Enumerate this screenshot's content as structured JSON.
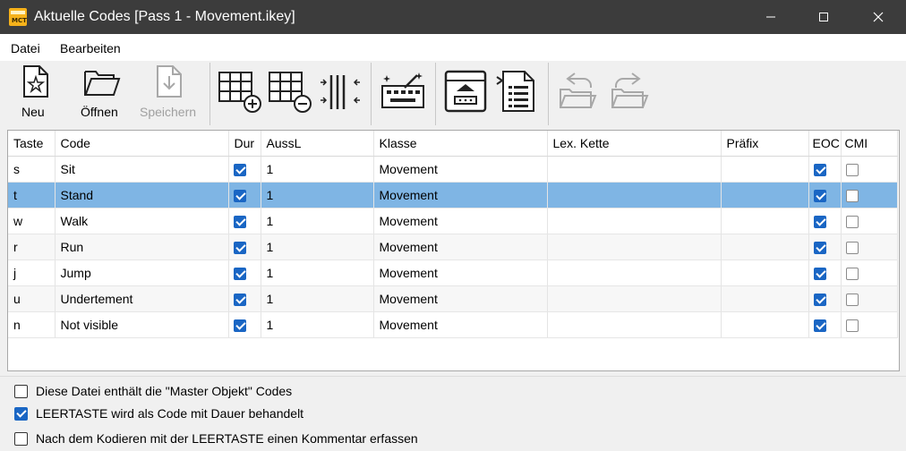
{
  "window": {
    "title": "Aktuelle Codes [Pass 1 - Movement.ikey]",
    "logo_text": "MCT",
    "controls": {
      "minimize": "minimize-icon",
      "maximize": "maximize-icon",
      "close": "close-icon"
    }
  },
  "menu": {
    "items": [
      "Datei",
      "Bearbeiten"
    ]
  },
  "toolbar": {
    "new_label": "Neu",
    "open_label": "Öffnen",
    "save_label": "Speichern",
    "icons": [
      "new-file-icon",
      "open-folder-icon",
      "save-icon",
      "add-row-icon",
      "remove-row-icon",
      "columns-icon",
      "wizard-icon",
      "export-icon",
      "document-list-icon",
      "undo-folder-icon",
      "redo-folder-icon"
    ]
  },
  "table": {
    "columns": [
      "Taste",
      "Code",
      "Dur",
      "AussL",
      "Klasse",
      "Lex. Kette",
      "Präfix",
      "EOC",
      "CMI"
    ],
    "rows": [
      {
        "key": "s",
        "code": "Sit",
        "dur": true,
        "aussl": "1",
        "klasse": "Movement",
        "lex": "",
        "prefix": "",
        "eoc": true,
        "cmi": false
      },
      {
        "key": "t",
        "code": "Stand",
        "dur": true,
        "aussl": "1",
        "klasse": "Movement",
        "lex": "",
        "prefix": "",
        "eoc": true,
        "cmi": false
      },
      {
        "key": "w",
        "code": "Walk",
        "dur": true,
        "aussl": "1",
        "klasse": "Movement",
        "lex": "",
        "prefix": "",
        "eoc": true,
        "cmi": false
      },
      {
        "key": "r",
        "code": "Run",
        "dur": true,
        "aussl": "1",
        "klasse": "Movement",
        "lex": "",
        "prefix": "",
        "eoc": true,
        "cmi": false
      },
      {
        "key": "j",
        "code": "Jump",
        "dur": true,
        "aussl": "1",
        "klasse": "Movement",
        "lex": "",
        "prefix": "",
        "eoc": true,
        "cmi": false
      },
      {
        "key": "u",
        "code": "Undertement",
        "dur": true,
        "aussl": "1",
        "klasse": "Movement",
        "lex": "",
        "prefix": "",
        "eoc": true,
        "cmi": false
      },
      {
        "key": "n",
        "code": "Not visible",
        "dur": true,
        "aussl": "1",
        "klasse": "Movement",
        "lex": "",
        "prefix": "",
        "eoc": true,
        "cmi": false
      }
    ],
    "selected_row": 1
  },
  "options": [
    {
      "label": "Diese Datei enthält die \"Master Objekt\" Codes",
      "checked": false
    },
    {
      "label": "LEERTASTE wird als Code mit Dauer behandelt",
      "checked": true
    },
    {
      "label": "Nach dem Kodieren mit der LEERTASTE einen Kommentar erfassen",
      "checked": false
    }
  ],
  "colors": {
    "titlebar": "#3c3c3c",
    "selection": "#7fb5e4",
    "checkbox": "#1a66c4",
    "disabled": "#a0a0a0"
  }
}
